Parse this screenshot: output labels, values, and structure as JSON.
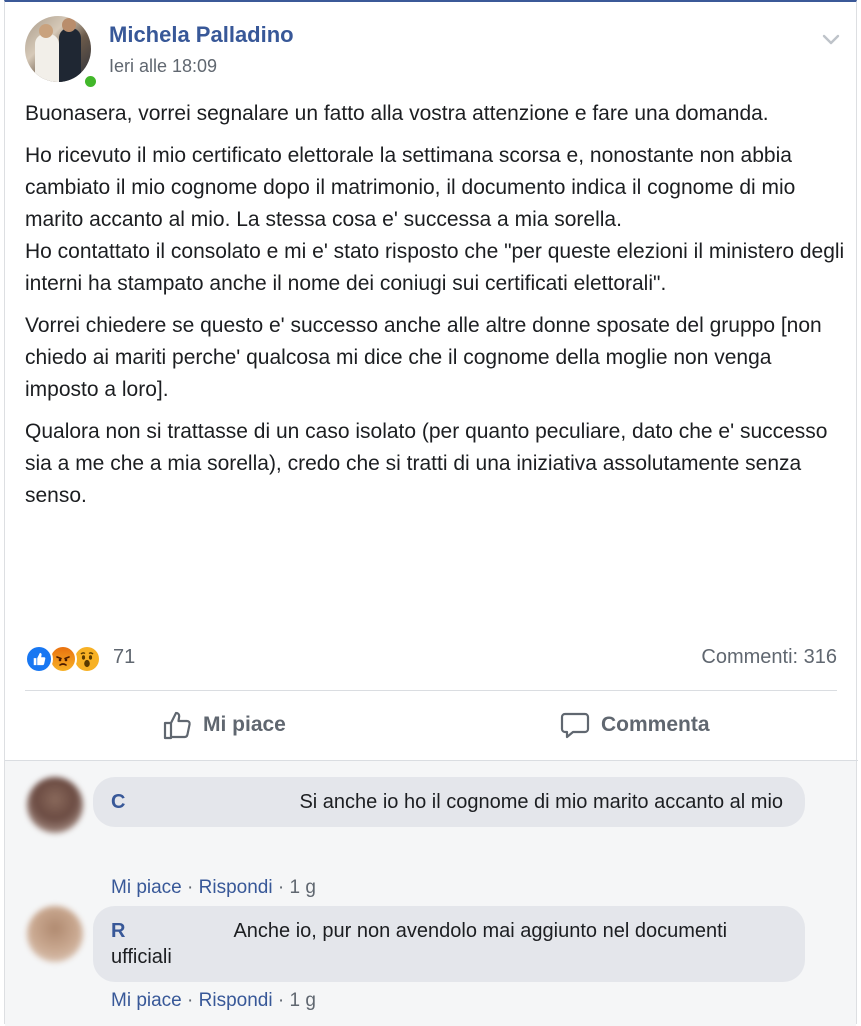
{
  "post": {
    "author": "Michela Palladino",
    "timestamp": "Ieri alle 18:09",
    "paragraphs": [
      "Buonasera, vorrei segnalare un fatto alla vostra attenzione e fare una domanda.",
      "Ho ricevuto il mio certificato elettorale la settimana scorsa e, nonostante non abbia cambiato il mio cognome dopo il matrimonio, il documento indica il cognome di mio marito accanto al mio. La stessa cosa e' successa a mia sorella.\nHo contattato il consolato e mi e' stato risposto che \"per queste elezioni il ministero degli interni ha stampato anche il nome dei coniugi sui certificati elettorali\".",
      "Vorrei chiedere se questo e' successo anche alle altre donne sposate del gruppo [non chiedo ai mariti perche' qualcosa mi dice che il cognome della moglie non venga imposto a loro].",
      "Qualora non si trattasse di un caso isolato (per quanto peculiare, dato che e' successo sia a me che a mia sorella), credo che si tratti di una iniziativa assolutamente senza senso."
    ],
    "reaction_icons": [
      "like-icon",
      "angry-icon",
      "wow-icon"
    ],
    "reaction_count": "71",
    "comments_count": "Commenti: 316"
  },
  "actions": {
    "like_label": "Mi piace",
    "comment_label": "Commenta"
  },
  "comments": [
    {
      "name": "C",
      "text": "Si anche io ho il cognome di mio marito accanto al mio",
      "like": "Mi piace",
      "reply": "Rispondi",
      "age": "1 g"
    },
    {
      "name": "R",
      "text": "Anche io, pur non avendolo mai aggiunto nel documenti ufficiali",
      "like": "Mi piace",
      "reply": "Rispondi",
      "age": "1 g"
    }
  ],
  "colors": {
    "link": "#385898",
    "secondary_text": "#606770",
    "online": "#42b72a",
    "like_blue": "#1877f2"
  }
}
